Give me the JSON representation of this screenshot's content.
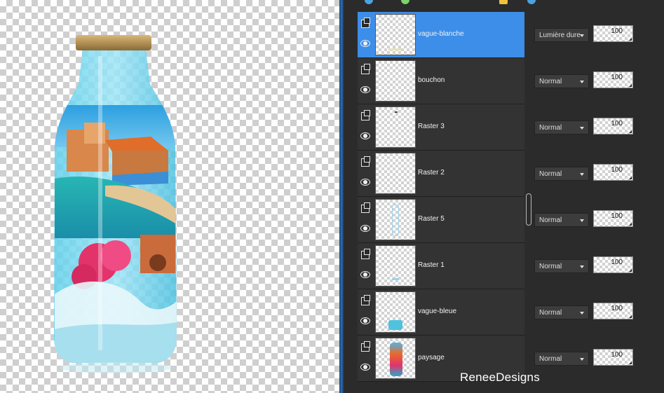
{
  "layers_panel": {
    "layers": [
      {
        "name": "vague-blanche",
        "blend_mode": "Lumière dure",
        "opacity": "100",
        "selected": true
      },
      {
        "name": "bouchon",
        "blend_mode": "Normal",
        "opacity": "100",
        "selected": false
      },
      {
        "name": "Raster 3",
        "blend_mode": "Normal",
        "opacity": "100",
        "selected": false
      },
      {
        "name": "Raster 2",
        "blend_mode": "Normal",
        "opacity": "100",
        "selected": false
      },
      {
        "name": "Raster 5",
        "blend_mode": "Normal",
        "opacity": "100",
        "selected": false
      },
      {
        "name": "Raster 1",
        "blend_mode": "Normal",
        "opacity": "100",
        "selected": false
      },
      {
        "name": "vague-bleue",
        "blend_mode": "Normal",
        "opacity": "100",
        "selected": false
      },
      {
        "name": "paysage",
        "blend_mode": "Normal",
        "opacity": "100",
        "selected": false
      }
    ],
    "icons": [
      "layer-icon",
      "eye-icon",
      "dropdown-arrow-icon"
    ]
  },
  "watermark": "ReneeDesigns",
  "colors": {
    "panel_bg": "#2b2b2b",
    "selected_row": "#3d8ee8",
    "divider": "#2b6db3"
  }
}
